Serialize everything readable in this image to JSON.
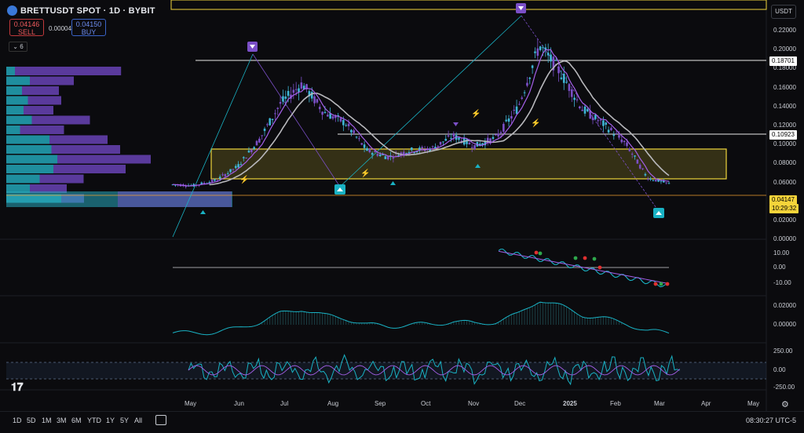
{
  "header": {
    "title": "BRETTUSDT SPOT · 1D · BYBIT",
    "sell_price": "0.04146",
    "sell_label": "SELL",
    "buy_price": "0.04150",
    "buy_label": "BUY",
    "spread": "0.00004",
    "indicator_count": "6"
  },
  "currency_selector": "USDT",
  "price_axis": {
    "ticks": [
      "0.22000",
      "0.20000",
      "0.18000",
      "0.16000",
      "0.14000",
      "0.12000",
      "0.10000",
      "0.08000",
      "0.06000",
      "0.04000",
      "0.02000",
      "0.00000"
    ],
    "tags": {
      "level_upper": "0.18701",
      "level_mid": "0.10923",
      "last_price": "0.04147",
      "countdown": "10:29:32"
    }
  },
  "osc1_axis": [
    "10.00",
    "0.00",
    "-10.00"
  ],
  "osc2_axis": [
    "0.02000",
    "0.00000"
  ],
  "osc3_axis": [
    "250.00",
    "0.00",
    "-250.00"
  ],
  "time_axis": [
    "May",
    "Jun",
    "Jul",
    "Aug",
    "Sep",
    "Oct",
    "Nov",
    "Dec",
    "2025",
    "Feb",
    "Mar",
    "Apr",
    "May"
  ],
  "range_buttons": [
    "1D",
    "5D",
    "1M",
    "3M",
    "6M",
    "YTD",
    "1Y",
    "5Y",
    "All"
  ],
  "clock": "08:30:27 UTC-5",
  "colors": {
    "background": "#0b0b0e",
    "candle_up": "#3fb6d6",
    "candle_down": "#7b4fc7",
    "zone": "#f0d63c",
    "signal_sell": "#7b4fc7",
    "signal_buy": "#19b2c4"
  },
  "icons": [
    "tradingview-logo-icon",
    "calendar-range-icon",
    "settings-gear-icon",
    "chevron-down-icon",
    "sell-signal-marker-icon",
    "buy-signal-marker-icon"
  ],
  "chart_data": {
    "type": "line",
    "title": "",
    "series": [
      {
        "name": "",
        "values": [
          0.04,
          0.039,
          0.045,
          0.061,
          0.092,
          0.135,
          0.158,
          0.125,
          0.112,
          0.08,
          0.072,
          0.08,
          0.082,
          0.097,
          0.085,
          0.095,
          0.13,
          0.203,
          0.17,
          0.128,
          0.11,
          0.088,
          0.048,
          0.041
        ]
      }
    ],
    "x": [
      "Apr-20",
      "May-1",
      "May-15",
      "Jun-1",
      "Jun-8",
      "Jun-20",
      "Jul-10",
      "Jul-25",
      "Aug-5",
      "Aug-20",
      "Sep-5",
      "Sep-20",
      "Oct-1",
      "Oct-15",
      "Oct-25",
      "Nov-5",
      "Nov-15",
      "Dec-1",
      "Dec-15",
      "Jan-1",
      "Jan-15",
      "Feb-1",
      "Feb-20",
      "Mar-5"
    ],
    "ylim": [
      0,
      0.23
    ],
    "ylabel": ""
  }
}
